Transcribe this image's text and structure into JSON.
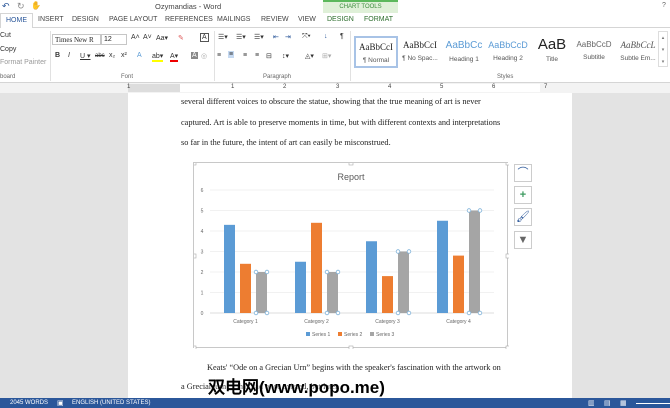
{
  "window": {
    "title": "Ozymandias - Word",
    "help": "?"
  },
  "tabs": [
    "HOME",
    "INSERT",
    "DESIGN",
    "PAGE LAYOUT",
    "REFERENCES",
    "MAILINGS",
    "REVIEW",
    "VIEW"
  ],
  "chart_tools": {
    "label": "CHART TOOLS",
    "tabs": [
      "DESIGN",
      "FORMAT"
    ]
  },
  "clipboard": {
    "cut": "Cut",
    "copy": "Copy",
    "format_painter": "Format Painter",
    "group": "board"
  },
  "font": {
    "name": "Times New R",
    "size": "12",
    "group": "Font"
  },
  "paragraph": {
    "group": "Paragraph"
  },
  "styles": {
    "group": "Styles",
    "items": [
      {
        "preview": "AaBbCcI",
        "name": "¶ Normal"
      },
      {
        "preview": "AaBbCcI",
        "name": "¶ No Spac..."
      },
      {
        "preview": "AaBbCc",
        "name": "Heading 1"
      },
      {
        "preview": "AaBbCcD",
        "name": "Heading 2"
      },
      {
        "preview": "AaB",
        "name": "Title"
      },
      {
        "preview": "AaBbCcD",
        "name": "Subtitle"
      },
      {
        "preview": "AaBbCcL",
        "name": "Subtle Em..."
      }
    ]
  },
  "ruler": [
    "1",
    "1",
    "2",
    "3",
    "4",
    "5",
    "6",
    "7"
  ],
  "document": {
    "lines": [
      "several different voices to obscure the statue, showing that the true meaning of art is never",
      "captured. Art is able to preserve moments in time, but with different contexts and interpretations",
      "so far in the future, the intent of art can easily be misconstrued.",
      "Keats' “Ode on a Grecian Urn” begins with the speaker's fascination with the artwork on",
      "a Grecian urn ... that had once existed, but later"
    ],
    "watermark": "双电网(www.popo.me)"
  },
  "status": {
    "words": "2045 WORDS",
    "language": "ENGLISH (UNITED STATES)"
  },
  "chart_data": {
    "type": "bar",
    "title": "Report",
    "categories": [
      "Category 1",
      "Category 2",
      "Category 3",
      "Category 4"
    ],
    "series": [
      {
        "name": "Series 1",
        "color": "#5b9bd5",
        "values": [
          4.3,
          2.5,
          3.5,
          4.5
        ]
      },
      {
        "name": "Series 2",
        "color": "#ed7d31",
        "values": [
          2.4,
          4.4,
          1.8,
          2.8
        ]
      },
      {
        "name": "Series 3",
        "color": "#a5a5a5",
        "values": [
          2,
          2,
          3,
          5
        ]
      }
    ],
    "ylim": [
      0,
      6
    ],
    "yticks": [
      "0",
      "1",
      "2",
      "3",
      "4",
      "5",
      "6"
    ],
    "grid": true,
    "legend": "bottom"
  }
}
